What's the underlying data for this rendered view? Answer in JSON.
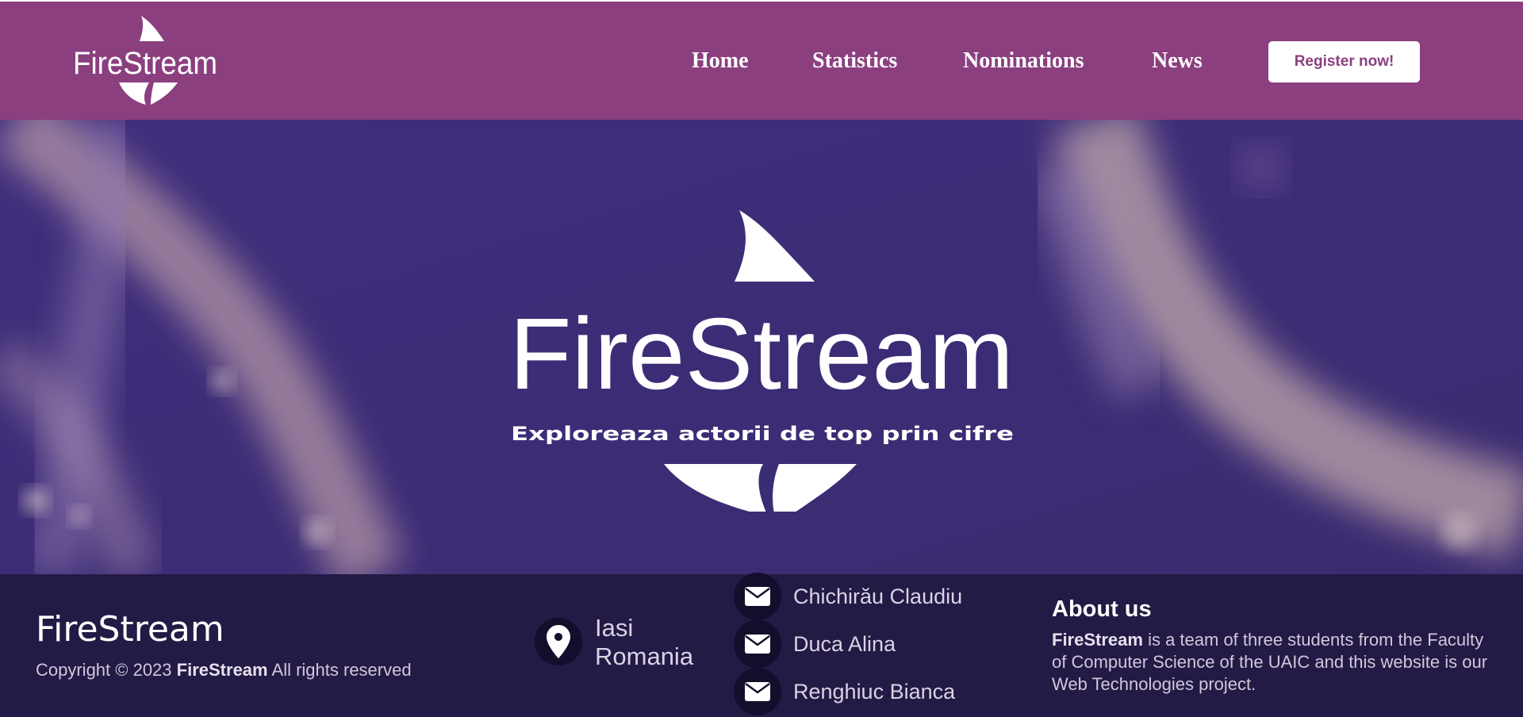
{
  "brand": {
    "name": "FireStream",
    "tagline": "Exploreaza actorii de top prin cifre"
  },
  "nav": {
    "items": [
      {
        "label": "Home"
      },
      {
        "label": "Statistics"
      },
      {
        "label": "Nominations"
      },
      {
        "label": "News"
      }
    ],
    "register_label": "Register now!"
  },
  "footer": {
    "brand": "FireStream",
    "copyright_prefix": "Copyright © 2023",
    "copyright_brand": "FireStream",
    "copyright_suffix": "All rights reserved",
    "location": {
      "city": "Iasi",
      "country": "Romania",
      "icon": "map-pin-icon"
    },
    "contacts": [
      {
        "name": "Chichirău Claudiu",
        "icon": "envelope-icon"
      },
      {
        "name": "Duca Alina",
        "icon": "envelope-icon"
      },
      {
        "name": "Renghiuc Bianca",
        "icon": "envelope-icon"
      }
    ],
    "about": {
      "title": "About us",
      "brand": "FireStream",
      "text": "is a team of three students from the Faculty of Computer Science of the UAIC and this website is our Web Technologies project."
    }
  },
  "colors": {
    "header_bg": "#8b3f7f",
    "hero_bg": "#3b2c74",
    "footer_bg": "#231a45",
    "icon_circle": "#140e2c"
  }
}
